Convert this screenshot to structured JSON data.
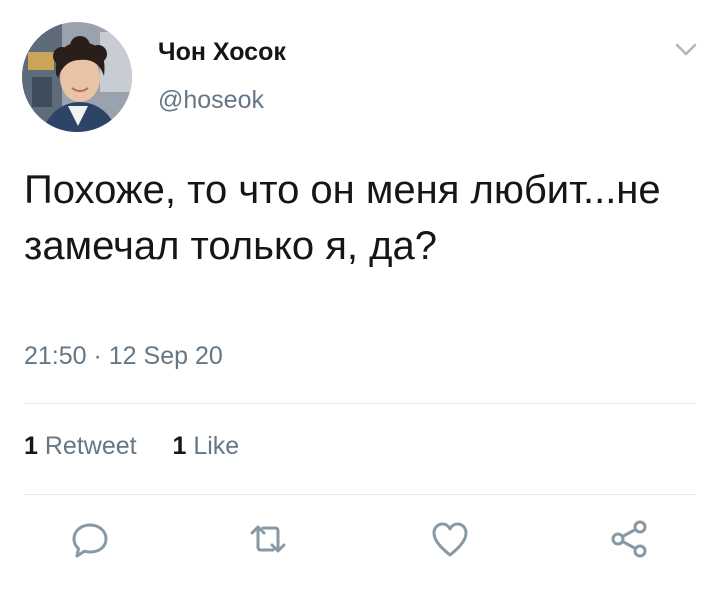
{
  "tweet": {
    "display_name": "Чон Хосок",
    "handle": "@hoseok",
    "text": "Похоже, то что он меня любит...не замечал только я, да?",
    "timestamp": "21:50 · 12 Sep 20"
  },
  "stats": {
    "retweet_count": "1",
    "retweet_label": "Retweet",
    "like_count": "1",
    "like_label": "Like"
  },
  "actions": {
    "icons": [
      "reply-icon",
      "retweet-icon",
      "like-icon",
      "share-icon"
    ]
  },
  "colors": {
    "text_primary": "#14171a",
    "text_secondary": "#657786",
    "icon_gray": "#8899a6",
    "divider": "#e1e8ed"
  }
}
